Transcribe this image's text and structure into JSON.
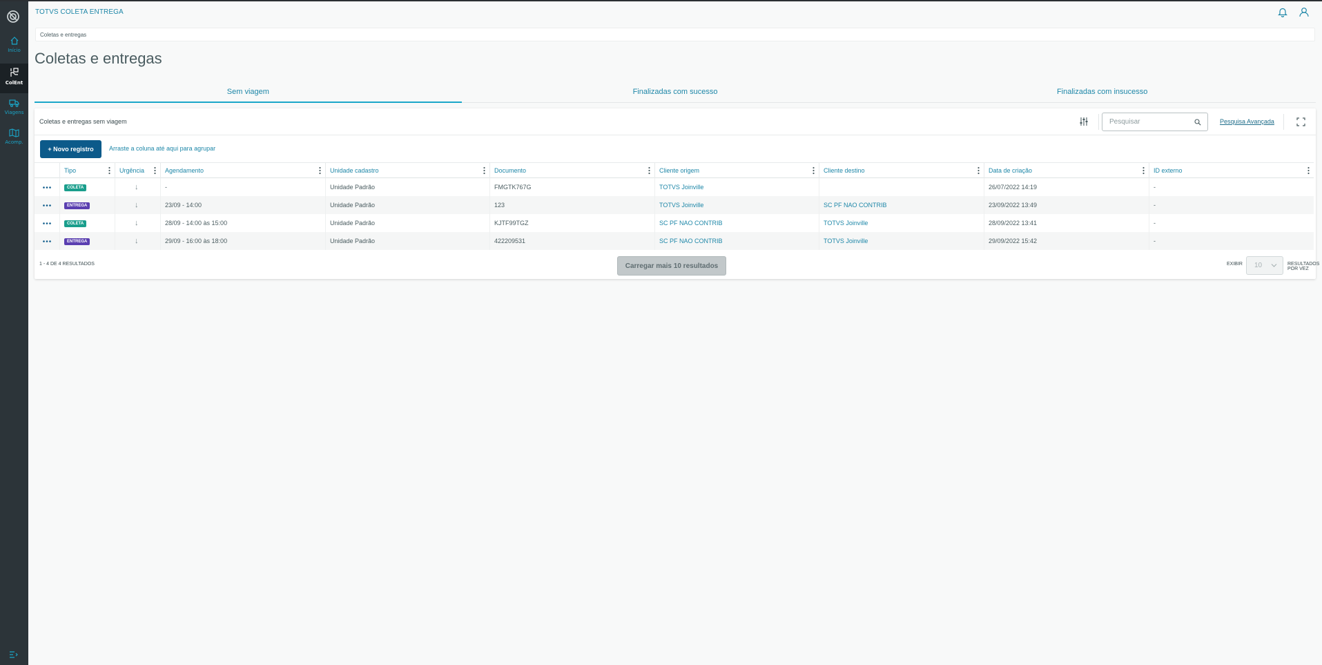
{
  "header": {
    "app_title": "TOTVS COLETA ENTREGA",
    "breadcrumb": "Coletas e entregas",
    "page_title": "Coletas e entregas"
  },
  "sidebar": {
    "items": [
      {
        "label": "Início",
        "icon": "home-icon"
      },
      {
        "label": "ColEnt",
        "icon": "hand-box-icon"
      },
      {
        "label": "Viagens",
        "icon": "truck-icon"
      },
      {
        "label": "Acomp.",
        "icon": "map-icon"
      }
    ],
    "active": "ColEnt"
  },
  "tabs": [
    {
      "label": "Sem viagem",
      "active": true
    },
    {
      "label": "Finalizadas com sucesso",
      "active": false
    },
    {
      "label": "Finalizadas com insucesso",
      "active": false
    }
  ],
  "table": {
    "title": "Coletas e entregas sem viagem",
    "search_placeholder": "Pesquisar",
    "advanced_search": "Pesquisa Avançada",
    "new_record": "+ Novo registro",
    "group_hint": "Arraste a coluna até aqui para agrupar",
    "columns": [
      "Tipo",
      "Urgência",
      "Agendamento",
      "Unidade cadastro",
      "Documento",
      "Cliente origem",
      "Cliente destino",
      "Data de criação",
      "ID externo"
    ],
    "rows": [
      {
        "tipo": "COLETA",
        "urgencia": "↓",
        "agendamento": "-",
        "unidade": "Unidade Padrão",
        "documento": "FMGTK767G",
        "origem": "TOTVS Joinville",
        "destino": "",
        "criacao": "26/07/2022 14:19",
        "id_externo": "-"
      },
      {
        "tipo": "ENTREGA",
        "urgencia": "↓",
        "agendamento": "23/09 - 14:00",
        "unidade": "Unidade Padrão",
        "documento": "123",
        "origem": "TOTVS Joinville",
        "destino": "SC PF NAO CONTRIB",
        "criacao": "23/09/2022 13:49",
        "id_externo": "-"
      },
      {
        "tipo": "COLETA",
        "urgencia": "↓",
        "agendamento": "28/09 - 14:00 às 15:00",
        "unidade": "Unidade Padrão",
        "documento": "KJTF99TGZ",
        "origem": "SC PF NAO CONTRIB",
        "destino": "TOTVS Joinville",
        "criacao": "28/09/2022 13:41",
        "id_externo": "-"
      },
      {
        "tipo": "ENTREGA",
        "urgencia": "↓",
        "agendamento": "29/09 - 16:00 às 18:00",
        "unidade": "Unidade Padrão",
        "documento": "422209531",
        "origem": "SC PF NAO CONTRIB",
        "destino": "TOTVS Joinville",
        "criacao": "29/09/2022 15:42",
        "id_externo": "-"
      }
    ],
    "result_count": "1 - 4 DE 4 RESULTADOS",
    "load_more": "Carregar mais 10 resultados",
    "show_label": "EXIBIR",
    "page_size": "10",
    "per_page_label": "RESULTADOS POR VEZ"
  },
  "colors": {
    "sidebar": "#2c3439",
    "accent": "#1aa6c9",
    "link": "#1e87a8",
    "primary_button": "#0c5a8a",
    "badge_coleta": "#1a9e8c",
    "badge_entrega": "#5a3fb0"
  }
}
